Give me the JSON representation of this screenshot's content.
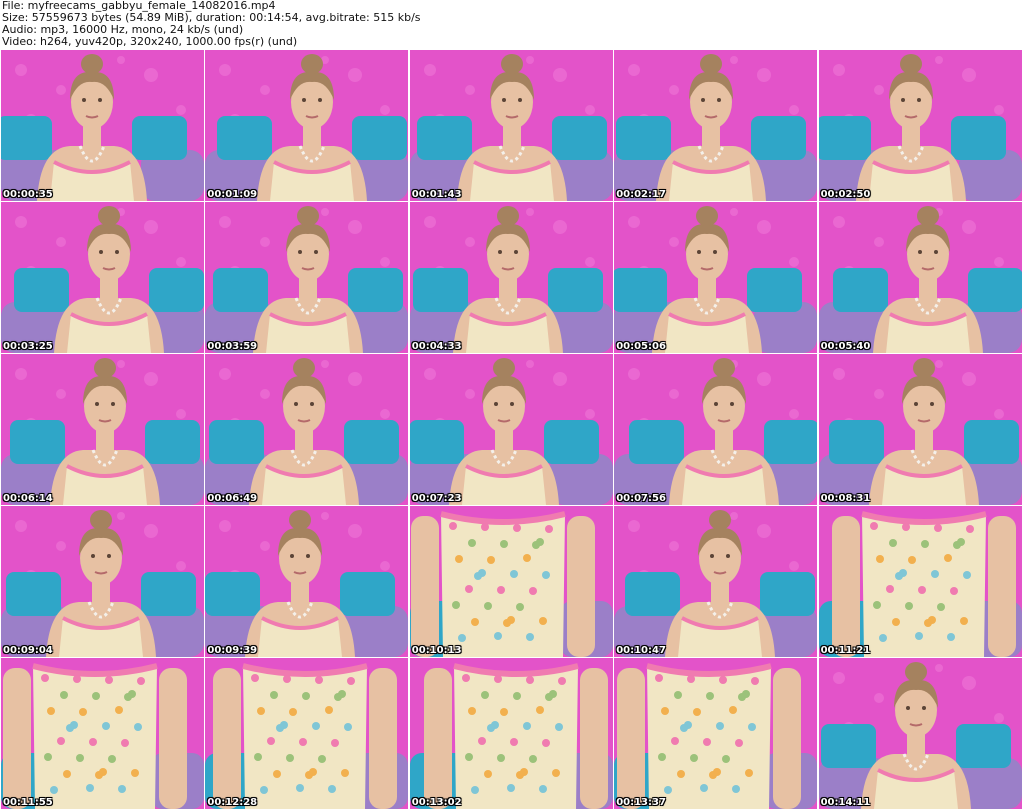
{
  "header": {
    "file": "File: myfreecams_gabbyu_female_14082016.mp4",
    "size": "Size: 57559673 bytes (54.89 MiB), duration: 00:14:54, avg.bitrate: 515 kb/s",
    "audio": "Audio: mp3, 16000 Hz, mono, 24 kb/s (und)",
    "video": "Video: h264, yuv420p, 320x240, 1000.00 fps(r) (und)"
  },
  "colors": {
    "wall": "#e353c9",
    "wall_dots": "#f07ad8",
    "pillow_blue": "#2fa6c8",
    "pillow_purple": "#9b7fc8",
    "skin": "#e7c1a3",
    "hair": "#a5825f",
    "dress": "#f1e6c4",
    "dress_trim": "#f07bb0"
  },
  "thumbnails": [
    {
      "time": "00:00:35",
      "kind": "portrait"
    },
    {
      "time": "00:01:09",
      "kind": "portrait"
    },
    {
      "time": "00:01:43",
      "kind": "portrait"
    },
    {
      "time": "00:02:17",
      "kind": "portrait"
    },
    {
      "time": "00:02:50",
      "kind": "portrait"
    },
    {
      "time": "00:03:25",
      "kind": "portrait"
    },
    {
      "time": "00:03:59",
      "kind": "portrait"
    },
    {
      "time": "00:04:33",
      "kind": "portrait"
    },
    {
      "time": "00:05:06",
      "kind": "portrait"
    },
    {
      "time": "00:05:40",
      "kind": "portrait"
    },
    {
      "time": "00:06:14",
      "kind": "portrait"
    },
    {
      "time": "00:06:49",
      "kind": "portrait"
    },
    {
      "time": "00:07:23",
      "kind": "portrait"
    },
    {
      "time": "00:07:56",
      "kind": "portrait"
    },
    {
      "time": "00:08:31",
      "kind": "portrait"
    },
    {
      "time": "00:09:04",
      "kind": "portrait"
    },
    {
      "time": "00:09:39",
      "kind": "portrait"
    },
    {
      "time": "00:10:13",
      "kind": "torso"
    },
    {
      "time": "00:10:47",
      "kind": "portrait"
    },
    {
      "time": "00:11:21",
      "kind": "torso"
    },
    {
      "time": "00:11:55",
      "kind": "torso"
    },
    {
      "time": "00:12:28",
      "kind": "torso"
    },
    {
      "time": "00:13:02",
      "kind": "torso"
    },
    {
      "time": "00:13:37",
      "kind": "torso"
    },
    {
      "time": "00:14:11",
      "kind": "portrait"
    }
  ]
}
